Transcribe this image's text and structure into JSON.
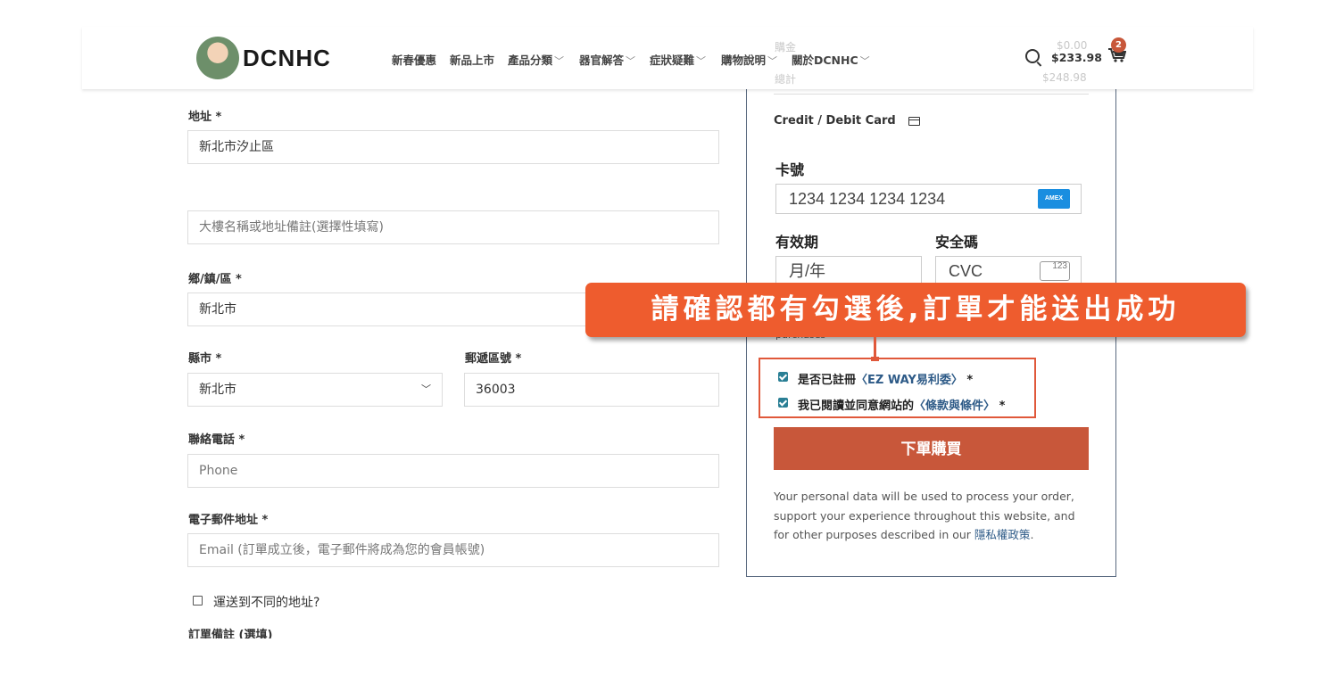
{
  "header": {
    "logo_text": "DCNHC",
    "nav": [
      {
        "label": "新春優惠",
        "chevron": false
      },
      {
        "label": "新品上市",
        "chevron": false
      },
      {
        "label": "產品分類",
        "chevron": true
      },
      {
        "label": "器官解答",
        "chevron": true
      },
      {
        "label": "症狀疑難",
        "chevron": true
      },
      {
        "label": "購物說明",
        "chevron": true
      },
      {
        "label": "關於DCNHC",
        "chevron": true
      }
    ],
    "cart_total": "$233.98",
    "cart_count": "2",
    "faded_top_left": "購金",
    "faded_top_right": "$0.00",
    "faded_bottom_left": "總計",
    "faded_bottom_right": "$248.98"
  },
  "form": {
    "address_label": "地址",
    "address_value": "新北市汐止區",
    "address2_placeholder": "大樓名稱或地址備註(選擇性填寫)",
    "district_label": "鄉/鎮/區",
    "district_value": "新北市",
    "city_label": "縣市",
    "city_value": "新北市",
    "postcode_label": "郵遞區號",
    "postcode_value": "36003",
    "phone_label": "聯絡電話",
    "phone_placeholder": "Phone",
    "email_label": "電子郵件地址",
    "email_placeholder": "Email (訂單成立後，電子郵件將成為您的會員帳號)",
    "ship_diff_label": "運送到不同的地址?",
    "order_notes_label": "訂單備註 (選填)",
    "required_mark": "*"
  },
  "payment": {
    "method_label": "Credit / Debit Card",
    "card_number_label": "卡號",
    "card_number_placeholder": "1234 1234 1234 1234",
    "card_brand": "AMEX",
    "expiry_label": "有效期",
    "expiry_placeholder": "月/年",
    "cvc_label": "安全碼",
    "cvc_placeholder": "CVC",
    "cvc_icon_text": "123",
    "partial_text": "purchases"
  },
  "terms": {
    "ezway_text": "是否已註冊",
    "ezway_link": "〈EZ WAY易利委〉",
    "agree_text": "我已閱讀並同意網站的",
    "agree_link": "〈條款與條件〉",
    "required_mark": "*"
  },
  "place_order_label": "下單購買",
  "privacy": {
    "text": "Your personal data will be used to process your order, support your experience throughout this website, and for other purposes described in our ",
    "link": "隱私權政策",
    "end": "."
  },
  "callout_text": "請確認都有勾選後,訂單才能送出成功",
  "colors": {
    "accent": "#c8573a",
    "callout": "#ee5c2e",
    "link": "#2d5a87",
    "checkbox": "#2a7f95"
  }
}
